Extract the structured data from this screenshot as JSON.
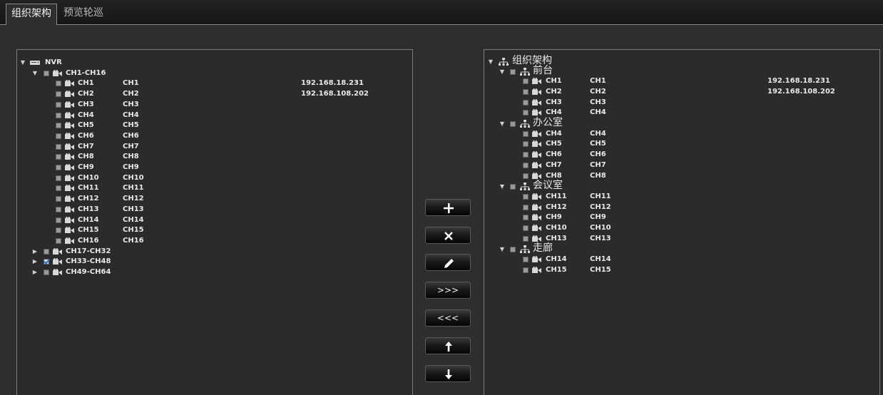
{
  "tabs": [
    {
      "label": "组织架构",
      "active": true
    },
    {
      "label": "预览轮巡",
      "active": false
    }
  ],
  "left_tree": {
    "root": {
      "label": "NVR",
      "icon": "nvr-device-icon",
      "expanded": true
    },
    "groups": [
      {
        "label": "CH1-CH16",
        "expanded": true,
        "checked": false
      },
      {
        "label": "CH17-CH32",
        "expanded": false,
        "checked": false
      },
      {
        "label": "CH33-CH48",
        "expanded": false,
        "checked": true
      },
      {
        "label": "CH49-CH64",
        "expanded": false,
        "checked": false
      }
    ],
    "channels": [
      {
        "label": "CH1",
        "name": "CH1",
        "ip": "192.168.18.231"
      },
      {
        "label": "CH2",
        "name": "CH2",
        "ip": "192.168.108.202"
      },
      {
        "label": "CH3",
        "name": "CH3",
        "ip": ""
      },
      {
        "label": "CH4",
        "name": "CH4",
        "ip": ""
      },
      {
        "label": "CH5",
        "name": "CH5",
        "ip": ""
      },
      {
        "label": "CH6",
        "name": "CH6",
        "ip": ""
      },
      {
        "label": "CH7",
        "name": "CH7",
        "ip": ""
      },
      {
        "label": "CH8",
        "name": "CH8",
        "ip": ""
      },
      {
        "label": "CH9",
        "name": "CH9",
        "ip": ""
      },
      {
        "label": "CH10",
        "name": "CH10",
        "ip": ""
      },
      {
        "label": "CH11",
        "name": "CH11",
        "ip": ""
      },
      {
        "label": "CH12",
        "name": "CH12",
        "ip": ""
      },
      {
        "label": "CH13",
        "name": "CH13",
        "ip": ""
      },
      {
        "label": "CH14",
        "name": "CH14",
        "ip": ""
      },
      {
        "label": "CH15",
        "name": "CH15",
        "ip": ""
      },
      {
        "label": "CH16",
        "name": "CH16",
        "ip": ""
      }
    ]
  },
  "right_tree": {
    "root": {
      "label": "组织架构",
      "icon": "org-structure-icon",
      "expanded": true
    },
    "groups": [
      {
        "label": "前台",
        "expanded": true,
        "channels": [
          {
            "label": "CH1",
            "name": "CH1",
            "ip": "192.168.18.231"
          },
          {
            "label": "CH2",
            "name": "CH2",
            "ip": "192.168.108.202"
          },
          {
            "label": "CH3",
            "name": "CH3",
            "ip": ""
          },
          {
            "label": "CH4",
            "name": "CH4",
            "ip": ""
          }
        ]
      },
      {
        "label": "办公室",
        "expanded": true,
        "channels": [
          {
            "label": "CH4",
            "name": "CH4",
            "ip": ""
          },
          {
            "label": "CH5",
            "name": "CH5",
            "ip": ""
          },
          {
            "label": "CH6",
            "name": "CH6",
            "ip": ""
          },
          {
            "label": "CH7",
            "name": "CH7",
            "ip": ""
          },
          {
            "label": "CH8",
            "name": "CH8",
            "ip": ""
          }
        ]
      },
      {
        "label": "会议室",
        "expanded": true,
        "channels": [
          {
            "label": "CH11",
            "name": "CH11",
            "ip": ""
          },
          {
            "label": "CH12",
            "name": "CH12",
            "ip": ""
          },
          {
            "label": "CH9",
            "name": "CH9",
            "ip": ""
          },
          {
            "label": "CH10",
            "name": "CH10",
            "ip": ""
          },
          {
            "label": "CH13",
            "name": "CH13",
            "ip": ""
          }
        ]
      },
      {
        "label": "走廊",
        "expanded": true,
        "channels": [
          {
            "label": "CH14",
            "name": "CH14",
            "ip": ""
          },
          {
            "label": "CH15",
            "name": "CH15",
            "ip": ""
          }
        ]
      }
    ]
  },
  "buttons": [
    {
      "name": "add-button",
      "icon": "plus-icon"
    },
    {
      "name": "delete-button",
      "icon": "close-icon"
    },
    {
      "name": "edit-button",
      "icon": "pencil-icon"
    },
    {
      "name": "add-all-button",
      "icon": "chevrons-right-icon",
      "label": ">>>"
    },
    {
      "name": "remove-all-button",
      "icon": "chevrons-left-icon",
      "label": "<<<"
    },
    {
      "name": "move-up-button",
      "icon": "arrow-up-icon"
    },
    {
      "name": "move-down-button",
      "icon": "arrow-down-icon"
    }
  ],
  "colors": {
    "background": "#2e2e2e",
    "panel_border": "#7c7c7c",
    "text": "#e8e8e8",
    "check_mark": "#1f6fd0"
  }
}
